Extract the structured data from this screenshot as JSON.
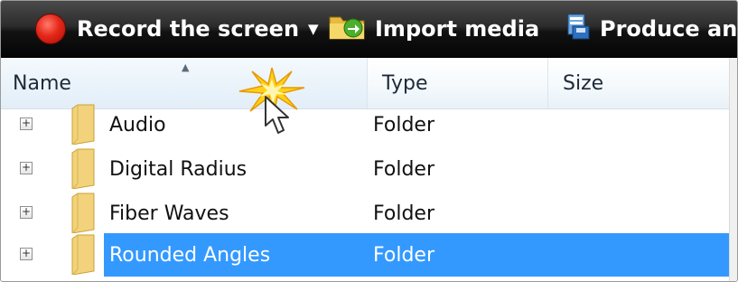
{
  "toolbar": {
    "record_label": "Record the screen",
    "import_label": "Import media",
    "produce_label": "Produce and share"
  },
  "columns": {
    "name": "Name",
    "type": "Type",
    "size": "Size"
  },
  "rows": [
    {
      "name": "Audio",
      "type": "Folder",
      "selected": false
    },
    {
      "name": "Digital Radius",
      "type": "Folder",
      "selected": false
    },
    {
      "name": "Fiber Waves",
      "type": "Folder",
      "selected": false
    },
    {
      "name": "Rounded Angles",
      "type": "Folder",
      "selected": true
    }
  ],
  "colors": {
    "selection": "#3399ff",
    "record_red": "#e5281a",
    "folder_yellow": "#f2d27a"
  },
  "icons": {
    "record": "record-dot-icon",
    "dropdown": "caret-down-icon",
    "import": "folder-arrow-icon",
    "produce": "film-disk-icon",
    "expander": "plus-box-icon",
    "folder": "folder-icon",
    "sort": "sort-ascending-icon",
    "cursor": "mouse-pointer-icon",
    "click": "click-burst-icon"
  }
}
